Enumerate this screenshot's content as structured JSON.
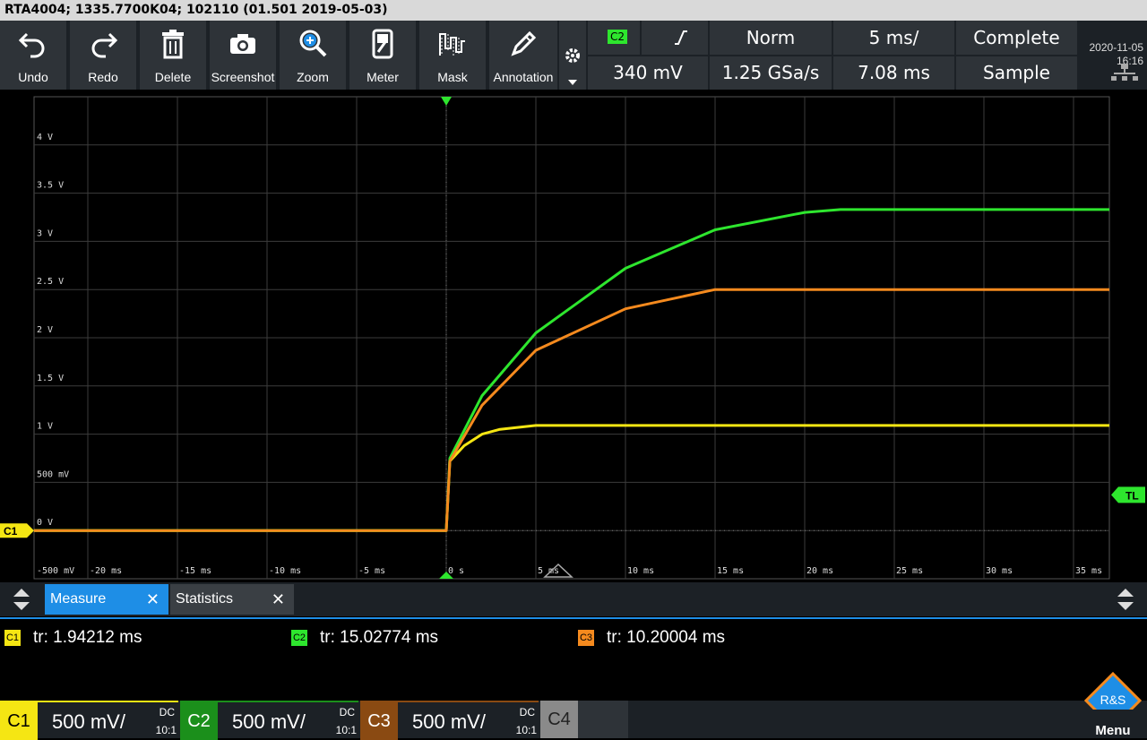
{
  "title": "RTA4004; 1335.7700K04; 102110 (01.501 2019-05-03)",
  "toolbar": [
    {
      "label": "Undo",
      "icon": "undo-icon"
    },
    {
      "label": "Redo",
      "icon": "redo-icon"
    },
    {
      "label": "Delete",
      "icon": "trash-icon"
    },
    {
      "label": "Screenshot",
      "icon": "camera-icon"
    },
    {
      "label": "Zoom",
      "icon": "zoom-icon"
    },
    {
      "label": "Meter",
      "icon": "meter-icon"
    },
    {
      "label": "Mask",
      "icon": "mask-icon"
    },
    {
      "label": "Annotation",
      "icon": "pencil-icon"
    }
  ],
  "trigger": {
    "source": "C2",
    "mode": "Norm",
    "timebase": "5 ms/",
    "acq_status": "Complete",
    "level": "340 mV",
    "sample_rate": "1.25 GSa/s",
    "position": "7.08 ms",
    "acq_mode": "Sample"
  },
  "datetime": {
    "date": "2020-11-05",
    "time": "16:16"
  },
  "tabs": {
    "measure": "Measure",
    "statistics": "Statistics"
  },
  "measurements": [
    {
      "channel": "C1",
      "text": "tr: 1.94212 ms",
      "color": "#f5e613"
    },
    {
      "channel": "C2",
      "text": "tr: 15.02774 ms",
      "color": "#2ee62e"
    },
    {
      "channel": "C3",
      "text": "tr: 10.20004 ms",
      "color": "#f58a1e"
    }
  ],
  "channels": [
    {
      "name": "C1",
      "scale": "500 mV/",
      "coupling": "DC",
      "ratio": "10:1"
    },
    {
      "name": "C2",
      "scale": "500 mV/",
      "coupling": "DC",
      "ratio": "10:1"
    },
    {
      "name": "C3",
      "scale": "500 mV/",
      "coupling": "DC",
      "ratio": "10:1"
    },
    {
      "name": "C4"
    }
  ],
  "menu_label": "Menu",
  "grid": {
    "y_labels": [
      "4 V",
      "3.5 V",
      "3 V",
      "2.5 V",
      "2 V",
      "1.5 V",
      "1 V",
      "500 mV",
      "0 V",
      "-500 mV"
    ],
    "x_labels": [
      "-20 ms",
      "-15 ms",
      "-10 ms",
      "-5 ms",
      "0 s",
      "5 ms",
      "10 ms",
      "15 ms",
      "20 ms",
      "25 ms",
      "30 ms",
      "35 ms"
    ],
    "trigger_level_marker": "TL",
    "channel_marker": "C1"
  },
  "chart_data": {
    "type": "line",
    "xlabel": "",
    "ylabel": "",
    "xlim": [
      -23,
      37
    ],
    "ylim": [
      -0.5,
      4.5
    ],
    "series": [
      {
        "channel": "C1",
        "color": "#f5e613",
        "x": [
          -23,
          0,
          0.2,
          1,
          2,
          3,
          5,
          10,
          37
        ],
        "y": [
          0,
          0,
          0.72,
          0.88,
          1.0,
          1.05,
          1.09,
          1.09,
          1.09
        ]
      },
      {
        "channel": "C2",
        "color": "#2ee62e",
        "x": [
          -23,
          0,
          0.2,
          2,
          5,
          10,
          15,
          20,
          22,
          37
        ],
        "y": [
          0,
          0,
          0.75,
          1.4,
          2.05,
          2.72,
          3.12,
          3.3,
          3.33,
          3.33
        ]
      },
      {
        "channel": "C3",
        "color": "#f58a1e",
        "x": [
          -23,
          0,
          0.2,
          2,
          5,
          10,
          15,
          37
        ],
        "y": [
          0,
          0,
          0.72,
          1.3,
          1.87,
          2.3,
          2.5,
          2.5
        ]
      }
    ]
  }
}
